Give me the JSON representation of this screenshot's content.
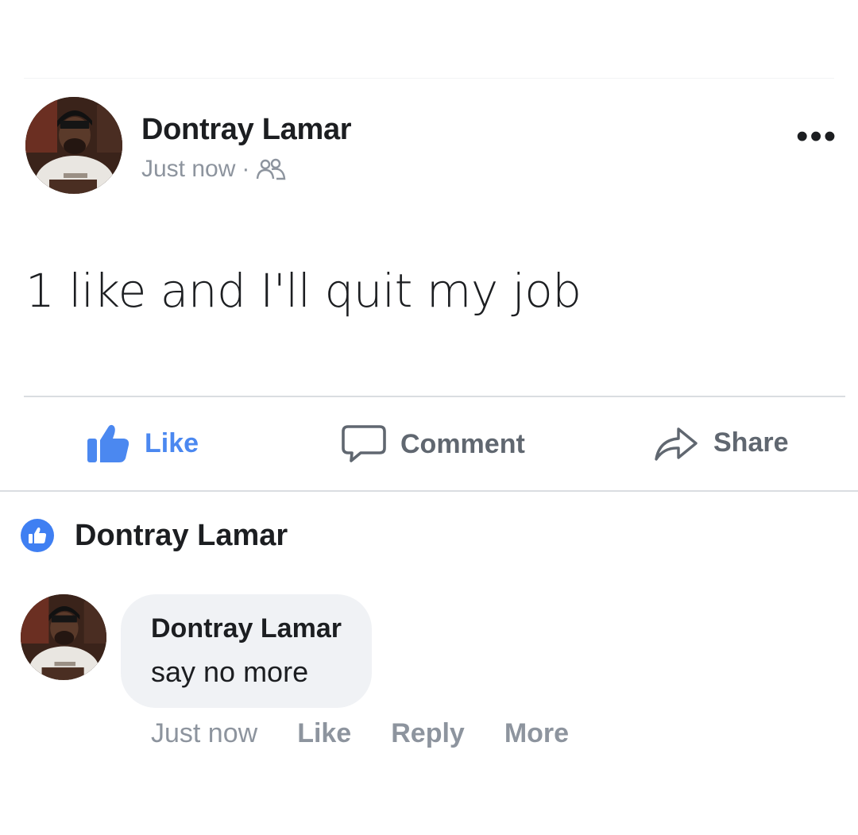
{
  "post": {
    "author": "Dontray Lamar",
    "timestamp": "Just now",
    "separator": "·",
    "audience_icon": "friends-icon",
    "more_icon": "more-dots-icon",
    "more_label": "•••",
    "text": "1 like and I'll quit my job"
  },
  "actions": {
    "like": "Like",
    "comment": "Comment",
    "share": "Share"
  },
  "reactions": {
    "icon": "like-badge-icon",
    "name": "Dontray Lamar"
  },
  "comment": {
    "author": "Dontray Lamar",
    "text": "say no more",
    "timestamp": "Just now",
    "like": "Like",
    "reply": "Reply",
    "more": "More"
  },
  "colors": {
    "like_blue": "#4b88f0",
    "gray_text": "#8d949e",
    "bubble_bg": "#f0f2f5",
    "divider": "#dadde1"
  }
}
